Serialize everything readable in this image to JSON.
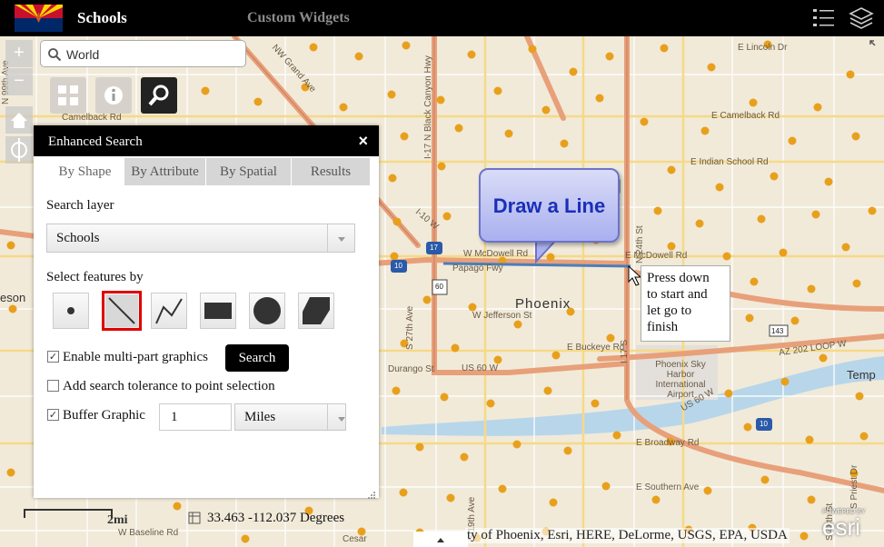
{
  "header": {
    "app_title": "Schools",
    "widgets_title": "Custom Widgets",
    "list_icon": "list-icon",
    "layers_icon": "layers-icon"
  },
  "search": {
    "value": "World",
    "placeholder": "World"
  },
  "map": {
    "city_label": "Phoenix",
    "callout": "Draw a Line",
    "tooltip_lines": [
      "Press down",
      "to start and",
      "let go to",
      "finish"
    ],
    "scale_label": "2mi",
    "coordinates": "33.463  -112.037 Degrees",
    "attribution": "ty of Phoenix, Esri, HERE, DeLorme, USGS, EPA, USDA",
    "logo_text": "esri",
    "logo_sub": "POWERED BY",
    "labels": {
      "e_lincoln": "E Lincoln Dr",
      "e_camelback": "E Camelback Rd",
      "camelback_w": "Camelback Rd",
      "e_indian_school": "E Indian School Rd",
      "w_mcdowell": "W McDowell Rd",
      "e_mcdowell": "E McDowell Rd",
      "papago": "Papago Fwy",
      "papago2": "Papago Fwy",
      "w_jefferson": "W Jefferson St",
      "e_buckeye": "E Buckeye Rd",
      "w_durango": "Durango St",
      "sky_harbor": "Phoenix Sky Harbor International Airport",
      "e_broadway": "E Broadway Rd",
      "e_southern": "E Southern Ave",
      "w_baseline": "W Baseline Rd",
      "ws_rd": "W S...",
      "tempe": "Temp",
      "eson": "eson",
      "az202": "AZ 202 LOOP W",
      "us60": "US 60 W",
      "us60b": "US-60 W",
      "i17": "I-17 N Black Canyon Hwy",
      "i10_hwy": "I-10 W",
      "i17_n": "I 17 S",
      "nw_grand": "NW Grand Ave",
      "us60_3": "US 60 W",
      "e_24th": "N 24th St",
      "s_7th": "S 7th St",
      "n_7th": "N 7th Ave",
      "n_19th": "N 19th Ave",
      "s_19th": "S 19th Ave",
      "s_48th": "S 48th St",
      "s_priest": "S Priest Dr",
      "n_99th": "N 99th Ave",
      "s_27th": "S 27th Ave",
      "w_maryland": "W Maryland Ave",
      "shield_17": "17",
      "shield_10": "10",
      "shield_60": "60",
      "shield_143": "143",
      "shield_10b": "10",
      "shield_51": "51",
      "cesar": "Cesar"
    }
  },
  "panel": {
    "title": "Enhanced Search",
    "close": "×",
    "tabs": [
      "By Shape",
      "By Attribute",
      "By Spatial",
      "Results"
    ],
    "search_layer_label": "Search layer",
    "search_layer_value": "Schools",
    "select_features_label": "Select features by",
    "multipart_label": "Enable multi-part graphics",
    "search_button": "Search",
    "tolerance_label": "Add search tolerance to point selection",
    "buffer_label": "Buffer Graphic",
    "buffer_value": "1",
    "units_value": "Miles",
    "multipart_checked": "✓",
    "buffer_checked": "✓"
  },
  "colors": {
    "header_bg": "#000000",
    "school_dot": "#e8a01c",
    "highway": "#e8a07a",
    "drawn_line": "#4a7fb8",
    "callout_text": "#1a2fb8",
    "selected_tool_border": "#e00000"
  }
}
